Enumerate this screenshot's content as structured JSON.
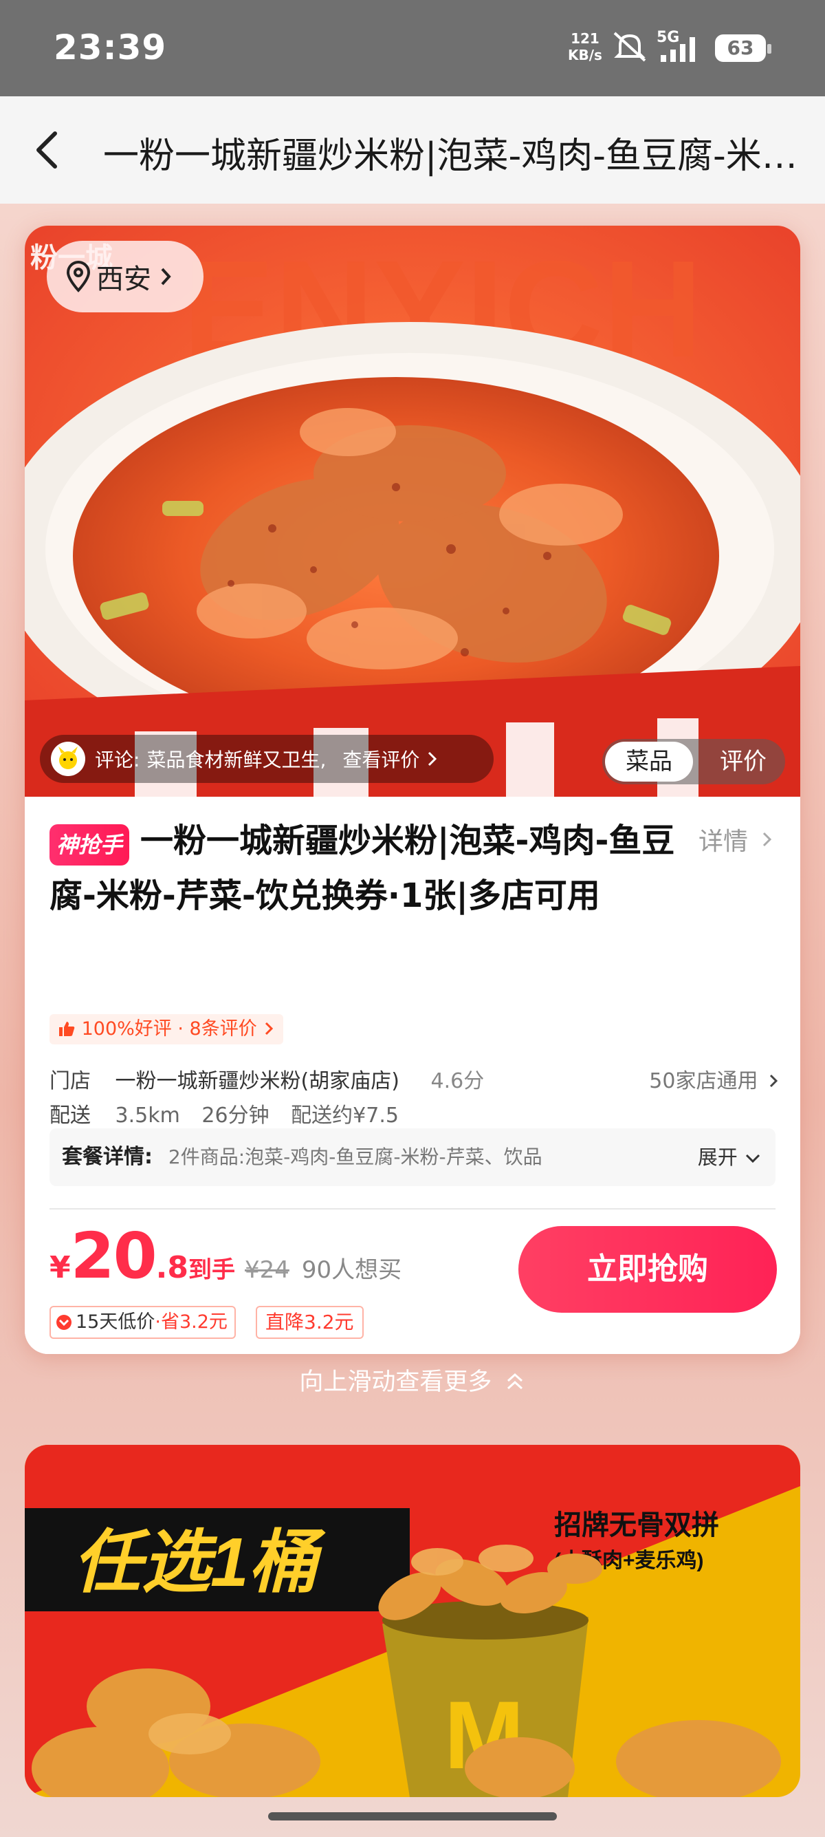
{
  "status_bar": {
    "time": "23:39",
    "net_speed": "121",
    "net_unit": "KB/s",
    "network_type": "5G",
    "battery": "63"
  },
  "nav": {
    "title": "一粉一城新疆炒米粉|泡菜-鸡肉-鱼豆腐-米粉-芹菜-饮兑换券·1张|多店可用"
  },
  "hero": {
    "location": "西安",
    "brand_watermark": "ENYICH",
    "brand_logo": "粉一城",
    "review_label": "评论:",
    "review_text": "菜品食材新鲜又卫生,",
    "review_link": "查看评价",
    "tab_dish": "菜品",
    "tab_review": "评价"
  },
  "deal": {
    "badge": "神抢手",
    "title": "一粉一城新疆炒米粉|泡菜-鸡肉-鱼豆腐-米粉-芹菜-饮兑换券·1张|多店可用",
    "detail_link": "详情",
    "rating": "100%好评 · 8条评价",
    "store_label": "门店",
    "store_name": "一粉一城新疆炒米粉(胡家庙店)",
    "store_score": "4.6分",
    "stores_available": "50家店通用",
    "delivery_label": "配送",
    "distance": "3.5km",
    "time": "26分钟",
    "delivery_fee": "配送约¥7.5",
    "package_label": "套餐详情:",
    "package_text": "2件商品:泡菜-鸡肉-鱼豆腐-米粉-芹菜、饮品",
    "package_expand": "展开",
    "price_symbol": "¥",
    "price_int": "20",
    "price_dec": ".8",
    "price_label": "到手",
    "original_price": "¥24",
    "want_count": "90人想买",
    "tag_low_text": "15天低价",
    "tag_low_save": "·省3.2元",
    "tag_drop": "直降3.2元",
    "buy_button": "立即抢购"
  },
  "swipe_hint": "向上滑动查看更多",
  "next_card": {
    "headline": "任选1桶",
    "sub1": "招牌无骨双拼",
    "sub2": "(小酥肉+麦乐鸡)"
  },
  "colors": {
    "accent": "#ff2d4a",
    "buy_button": "#ff2a5a",
    "rating": "#ff4a22",
    "status_bar": "#707070"
  }
}
